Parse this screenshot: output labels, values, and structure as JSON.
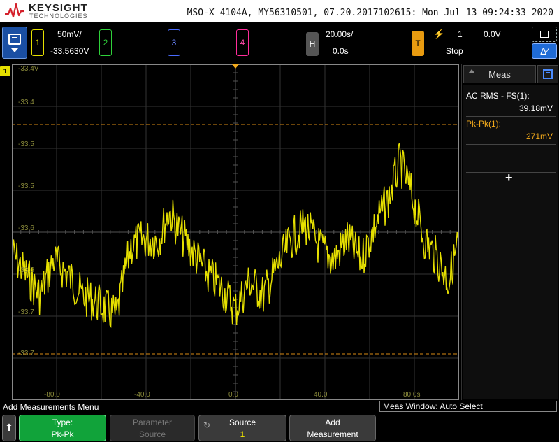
{
  "header": {
    "brand": "KEYSIGHT",
    "brand_sub": "TECHNOLOGIES",
    "instrument_info": "MSO-X 4104A, MY56310501, 07.20.2017102615: Mon Jul 13 09:24:33 2020"
  },
  "channels": {
    "ch1": {
      "label": "1",
      "scale": "50mV/",
      "offset": "-33.5630V",
      "color": "#e6e000"
    },
    "ch2": {
      "label": "2",
      "color": "#2fd13a"
    },
    "ch3": {
      "label": "3",
      "color": "#4a6bff"
    },
    "ch4": {
      "label": "4",
      "color": "#ff2d9a"
    }
  },
  "timebase": {
    "label": "H",
    "scale": "20.00s/",
    "delay": "0.0s"
  },
  "trigger": {
    "label": "T",
    "icon": "rising-edge-icon",
    "source": "1",
    "level": "0.0V",
    "state": "Stop",
    "color": "#f2a91b"
  },
  "graticule": {
    "ch1_marker": "1",
    "y_labels": [
      "-33.4V",
      "-33.4",
      "-33.5",
      "-33.5",
      "-33.6",
      "-33.6",
      "-33.7",
      "-33.7"
    ],
    "x_labels": [
      "-80.0",
      "-40.0",
      "0.0",
      "40.0",
      "80.0s"
    ]
  },
  "meas_panel": {
    "tab_label": "Meas",
    "measurements": [
      {
        "name": "AC RMS - FS(1):",
        "value": "39.18mV",
        "color": "#ffffff"
      },
      {
        "name": "Pk-Pk(1):",
        "value": "271mV",
        "color": "#f2a91b"
      }
    ],
    "add_label": "+"
  },
  "status": {
    "menu_title": "Add Measurements Menu",
    "meas_window": "Meas Window: Auto Select"
  },
  "softkeys": {
    "back_glyph": "⬆",
    "type": {
      "title": "Type:",
      "value": "Pk-Pk"
    },
    "parameter": {
      "title": "Parameter",
      "value": "Source"
    },
    "source": {
      "title": "Source",
      "value": "1",
      "rot_glyph": "↻"
    },
    "add": {
      "title": "Add",
      "value": "Measurement"
    }
  }
}
